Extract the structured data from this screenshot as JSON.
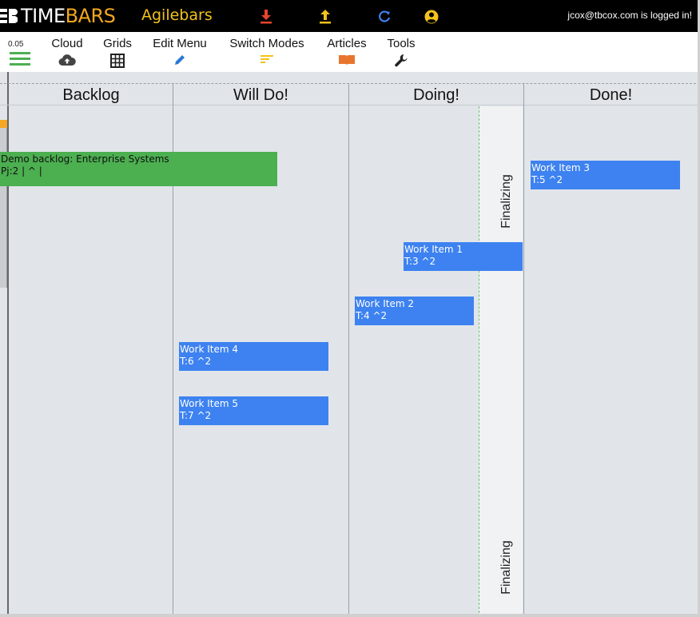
{
  "header": {
    "logo_time": "TIME",
    "logo_bars": "BARS",
    "app_title": "Agilebars",
    "login_status": "jcox@tbcox.com is logged in!",
    "icons": [
      "download-icon",
      "upload-icon",
      "refresh-icon",
      "account-icon"
    ]
  },
  "menubar": {
    "version": "0.05",
    "items": [
      {
        "label": "Cloud",
        "icon": "cloud-upload-icon"
      },
      {
        "label": "Grids",
        "icon": "grid-icon"
      },
      {
        "label": "Edit Menu",
        "icon": "pencil-icon"
      },
      {
        "label": "Switch Modes",
        "icon": "sort-lines-icon"
      },
      {
        "label": "Articles",
        "icon": "book-icon"
      },
      {
        "label": "Tools",
        "icon": "wrench-icon"
      }
    ]
  },
  "board": {
    "columns": [
      "Backlog",
      "Will Do!",
      "Doing!",
      "Done!"
    ],
    "finalizing_label": "Finalizing",
    "cards": [
      {
        "id": "demo-backlog",
        "title": "Demo backlog: Enterprise Systems",
        "meta": "Pj:2 | ^ |",
        "color": "#4caf50"
      },
      {
        "id": "work-item-3",
        "title": "Work Item 3",
        "meta": "T:5 ^2",
        "color": "#3d82f0"
      },
      {
        "id": "work-item-1",
        "title": "Work Item 1",
        "meta": "T:3 ^2",
        "color": "#3d82f0"
      },
      {
        "id": "work-item-2",
        "title": "Work Item 2",
        "meta": "T:4 ^2",
        "color": "#3d82f0"
      },
      {
        "id": "work-item-4",
        "title": "Work Item 4",
        "meta": "T:6 ^2",
        "color": "#3d82f0"
      },
      {
        "id": "work-item-5",
        "title": "Work Item 5",
        "meta": "T:7 ^2",
        "color": "#3d82f0"
      }
    ]
  },
  "colors": {
    "topbar_bg": "#000000",
    "logo_accent": "#f2a81d",
    "app_title": "#f2c21d",
    "download": "#e8442e",
    "upload": "#f2c21d",
    "refresh": "#3d82f0",
    "board_bg": "#e1e5ea",
    "card_blue": "#3d82f0",
    "card_green": "#4caf50"
  }
}
